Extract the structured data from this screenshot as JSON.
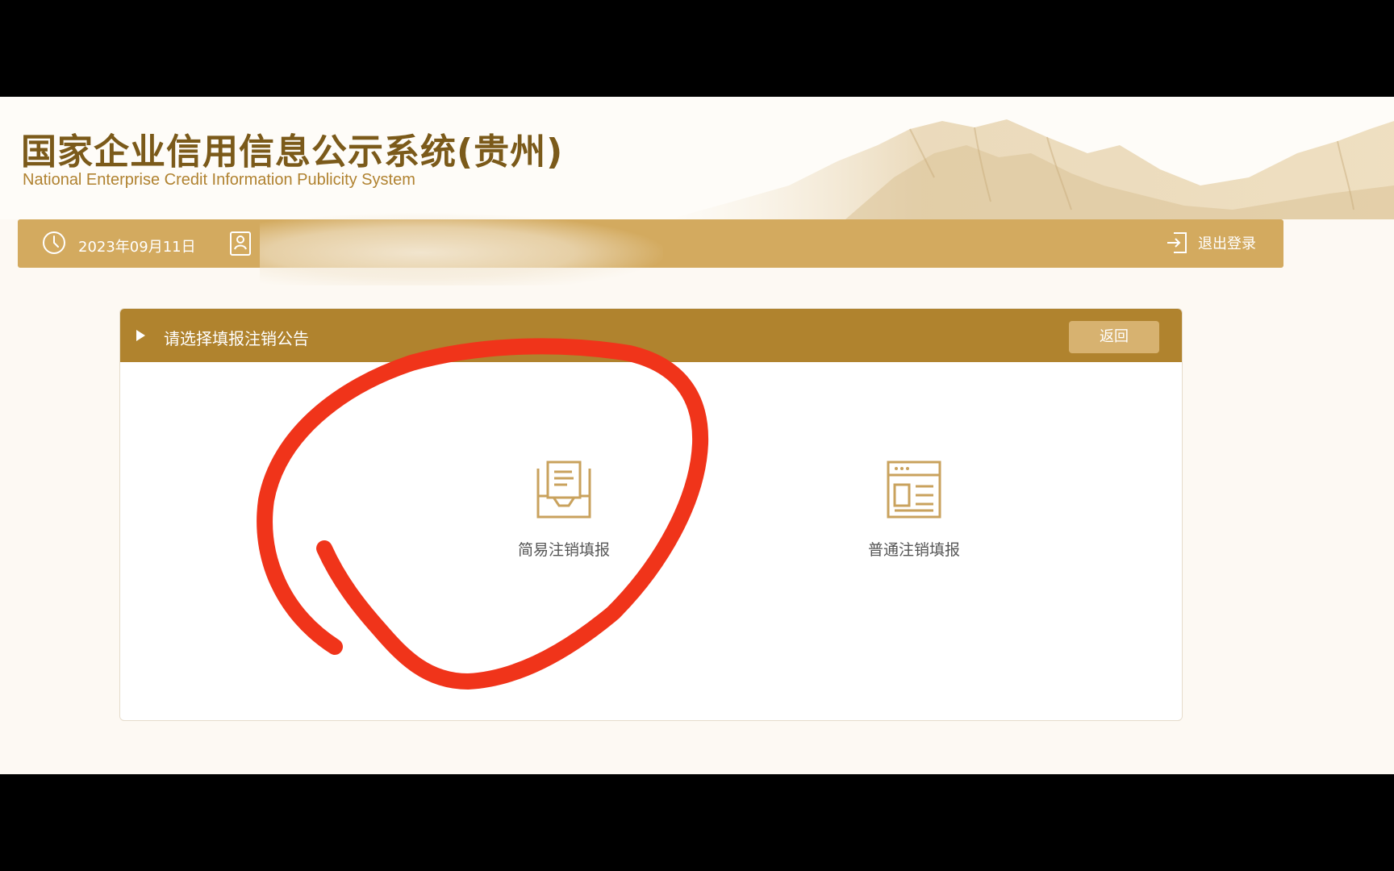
{
  "header": {
    "title_cn": "国家企业信用信息公示系统(贵州)",
    "title_en": "National Enterprise Credit Information Publicity System"
  },
  "topbar": {
    "date": "2023年09月11日",
    "logout_label": "退出登录"
  },
  "panel": {
    "title": "请选择填报注销公告",
    "back_label": "返回",
    "options": [
      {
        "label": "简易注销填报",
        "icon": "tray-document-icon"
      },
      {
        "label": "普通注销填报",
        "icon": "news-document-icon"
      }
    ]
  },
  "colors": {
    "accent_dark": "#b0832e",
    "accent_light": "#d3aa5f",
    "title_brown": "#7b5a1a",
    "annotation_red": "#f0341a"
  }
}
